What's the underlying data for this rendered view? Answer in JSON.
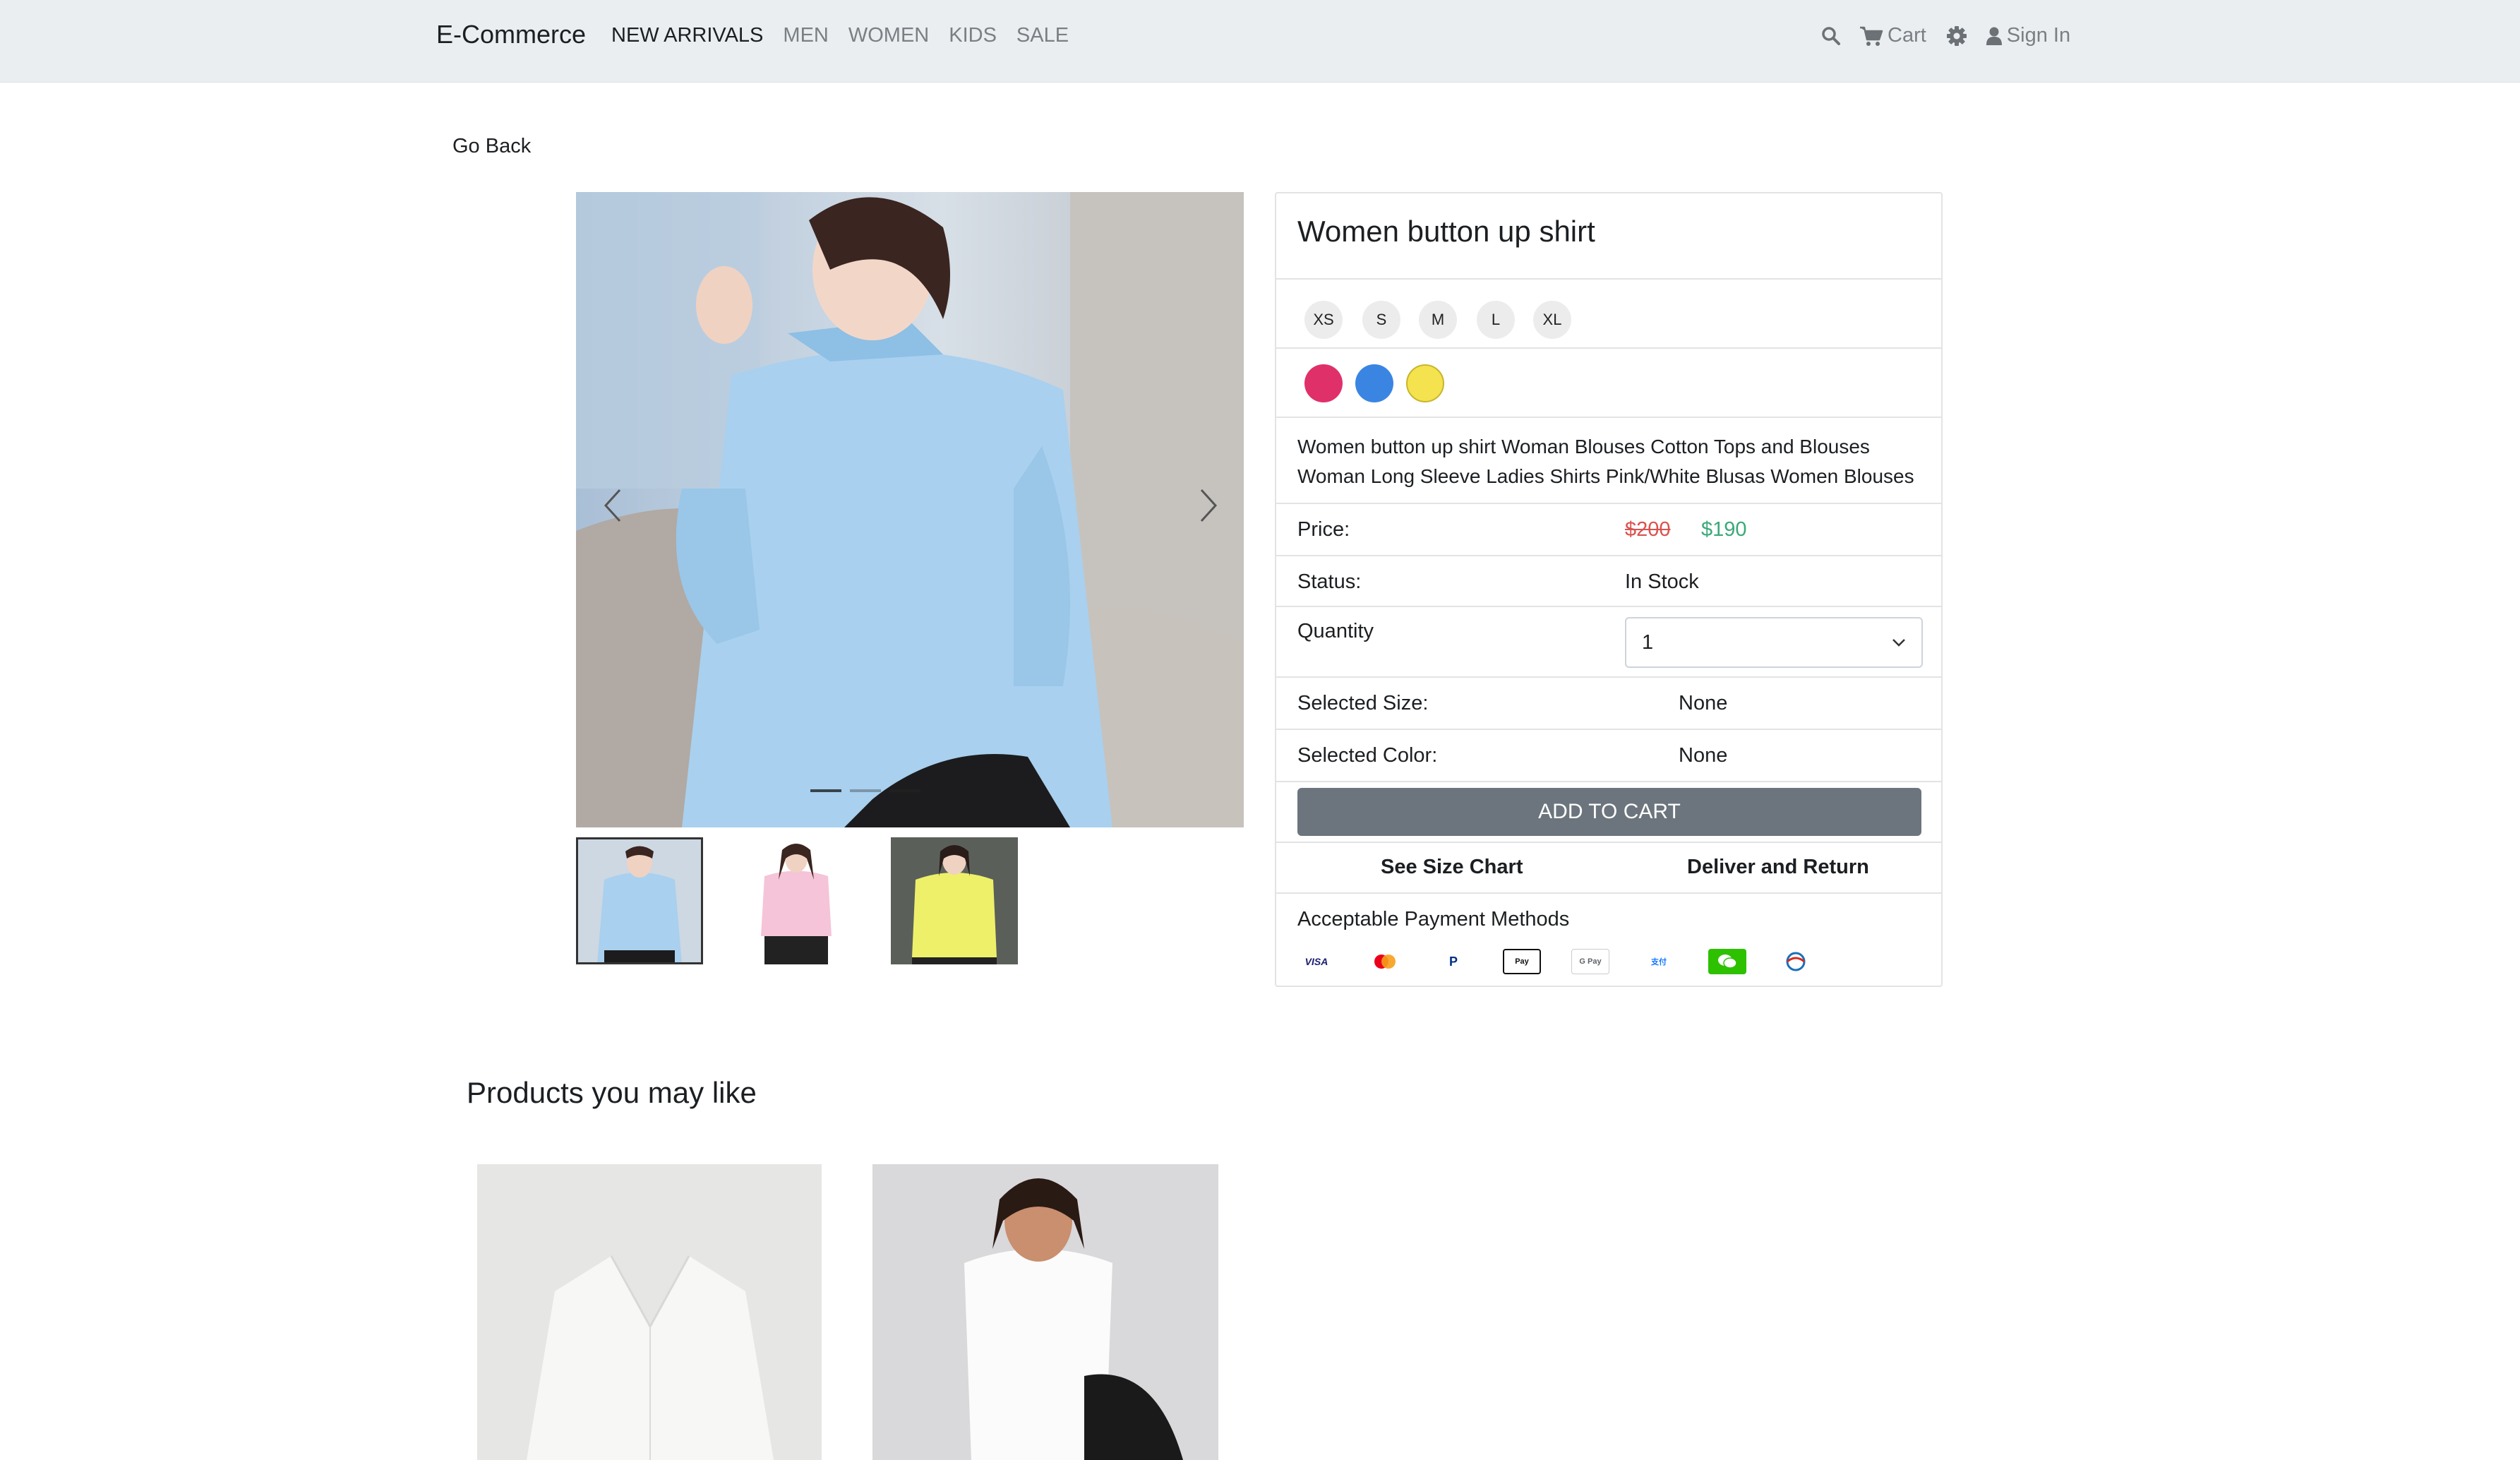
{
  "nav": {
    "brand": "E-Commerce",
    "links": [
      "NEW ARRIVALS",
      "MEN",
      "WOMEN",
      "KIDS",
      "SALE"
    ],
    "cart_label": "Cart",
    "signin_label": "Sign In"
  },
  "go_back": "Go Back",
  "product": {
    "title": "Women button up shirt",
    "sizes": [
      "XS",
      "S",
      "M",
      "L",
      "XL"
    ],
    "colors": [
      "#e0306a",
      "#3a85e2",
      "#f4e24e"
    ],
    "description": "Women button up shirt Woman Blouses Cotton Tops and Blouses Woman Long Sleeve Ladies Shirts Pink/White Blusas Women Blouses",
    "price_label": "Price:",
    "old_price": "$200",
    "new_price": "$190",
    "status_label": "Status:",
    "status_value": "In Stock",
    "quantity_label": "Quantity",
    "quantity_value": "1",
    "selected_size_label": "Selected Size:",
    "selected_size_value": "None",
    "selected_color_label": "Selected Color:",
    "selected_color_value": "None",
    "add_to_cart": "ADD TO CART",
    "size_chart": "See Size Chart",
    "deliver_return": "Deliver and Return",
    "payment_title": "Acceptable Payment Methods",
    "payment_methods": [
      "VISA",
      "Mastercard",
      "PayPal",
      "Apple Pay",
      "G Pay",
      "Alipay",
      "WeChat Pay",
      "UnionPay"
    ]
  },
  "related_title": "Products you may like"
}
